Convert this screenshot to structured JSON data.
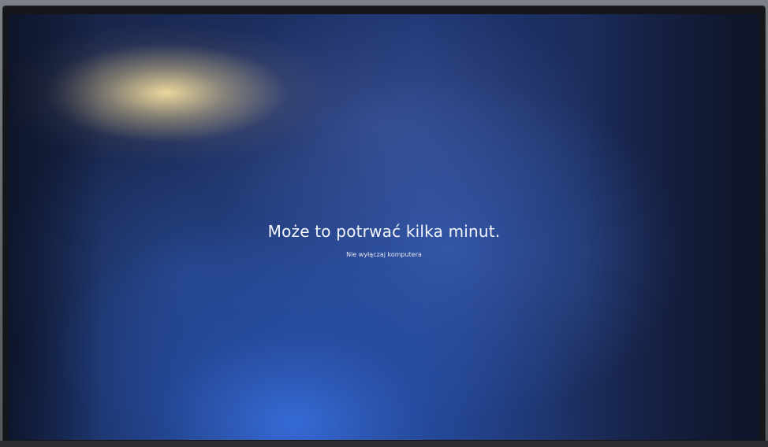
{
  "screen": {
    "title": "Może to potrwać kilka minut.",
    "subtitle": "Nie wyłączaj komputera"
  },
  "colors": {
    "background_blue": "#203775",
    "text": "#f4f6fb",
    "glare": "#f6e0a0"
  }
}
